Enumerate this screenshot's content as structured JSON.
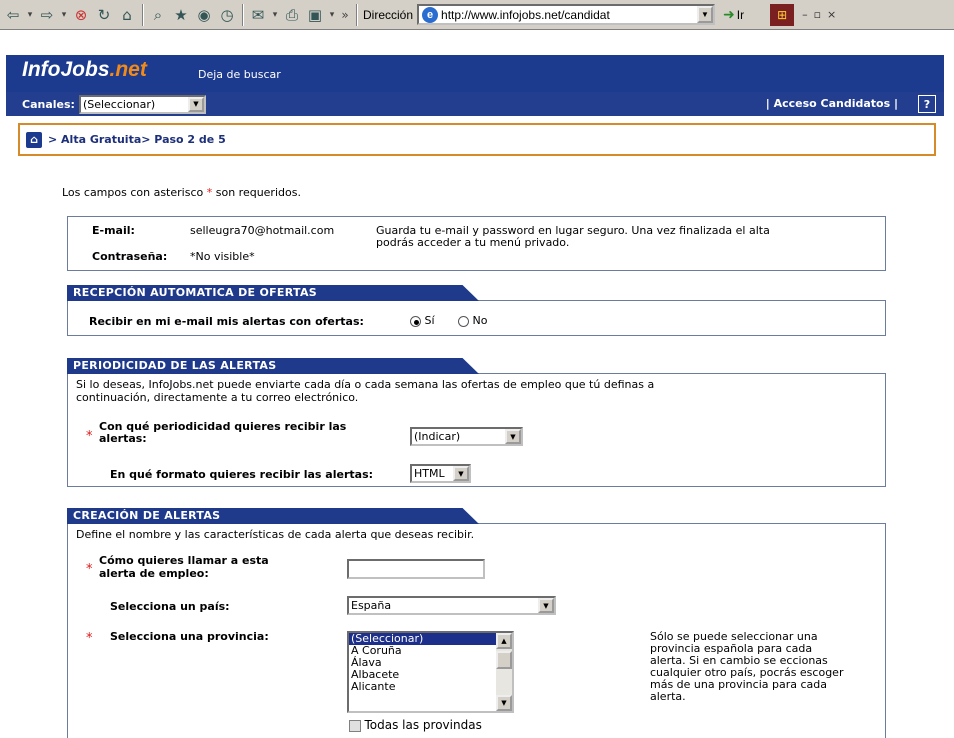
{
  "browser": {
    "address_label": "Dirección",
    "url": "http://www.infojobs.net/candidat",
    "go_label": "Ir",
    "chevron": "»"
  },
  "site": {
    "logo_main": "InfoJobs",
    "logo_ext": ".net",
    "tagline": "Deja de buscar",
    "channels_label": "Canales:",
    "channels_value": "(Seleccionar)",
    "access_label": "| Acceso Candidatos |",
    "help_label": "?",
    "breadcrumb": "> Alta Gratuita> Paso 2 de 5"
  },
  "form": {
    "required_note_prefix": "Los campos con asterisco",
    "required_note_suffix": "son requeridos.",
    "asterisk": "*",
    "email_label": "E-mail:",
    "email_value": "selleugra70@hotmail.com",
    "password_label": "Contraseña:",
    "password_value": "*No visible*",
    "security_note_1": "Guarda tu e-mail y password en lugar seguro. Una vez finalizada el alta",
    "security_note_2": "podrás acceder a tu menú privado.",
    "sec1_title": "RECEPCIÓN AUTOMATICA DE OFERTAS",
    "receive_label": "Recibir en mi e-mail mis alertas con ofertas:",
    "yes_label": "Sí",
    "no_label": "No",
    "sec2_title": "PERIODICIDAD DE LAS ALERTAS",
    "sec2_desc_1": "Si lo deseas, InfoJobs.net puede enviarte cada día o cada semana las ofertas de empleo que tú definas a",
    "sec2_desc_2": "continuación, directamente a tu correo electrónico.",
    "freq_label_1": "Con qué periodicidad quieres recibir las",
    "freq_label_2": "alertas:",
    "freq_value": "(Indicar)",
    "format_label": "En qué formato quieres recibir las alertas:",
    "format_value": "HTML",
    "sec3_title": "CREACIÓN DE ALERTAS",
    "sec3_desc": "Define el nombre y las características de cada alerta que deseas recibir.",
    "name_label_1": "Cómo quieres llamar a esta",
    "name_label_2": "alerta de empleo:",
    "name_value": "",
    "country_label": "Selecciona un país:",
    "country_value": "España",
    "province_label": "Selecciona una provincia:",
    "provinces": [
      "(Seleccionar)",
      "A Coruña",
      "Álava",
      "Albacete",
      "Alicante"
    ],
    "all_provinces_label": "Todas las provindas",
    "province_note": [
      "Sólo se puede seleccionar una",
      "provincia española para cada",
      "alerta. Si en cambio se eccionas",
      "cualquier otro país, pocrás escoger",
      "más de una provincia para cada",
      "alerta."
    ]
  },
  "colors": {
    "brand_blue": "#1c3b8e",
    "brand_orange": "#f28a1a",
    "required_red": "#e01818"
  }
}
